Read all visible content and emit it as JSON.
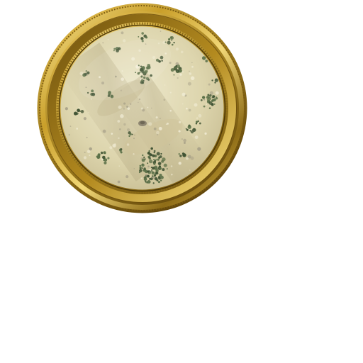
{
  "minimap": {
    "frame_style": "ornate-gold-round",
    "terrain": "desert",
    "colors": {
      "frame_gold_light": "#f3dc84",
      "frame_gold_mid": "#c9a230",
      "frame_gold_dark": "#6b4e0c",
      "sand_light": "#ece6c6",
      "sand_mid": "#d3c9a0",
      "sand_dark": "#b9ad84",
      "vegetation": "#5b7048",
      "vegetation_dark": "#3f5233",
      "stone": "#9a9480"
    }
  }
}
